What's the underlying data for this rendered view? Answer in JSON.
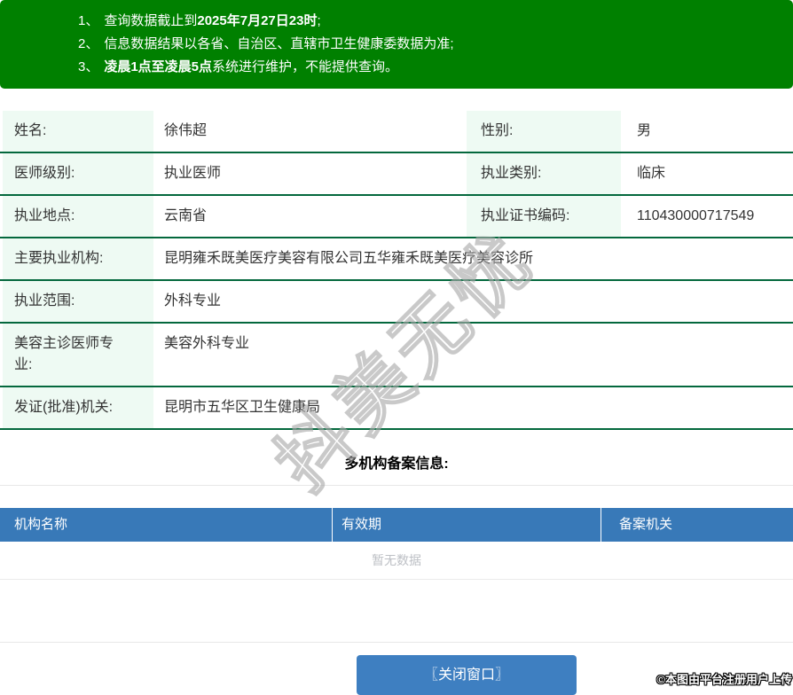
{
  "colors": {
    "banner_green": "#008000",
    "row_divider_green": "#04683d",
    "label_bg_mint": "#eefaf3",
    "filing_header_blue": "#3879b8",
    "close_button_blue": "#3e7fc1",
    "empty_text_gray": "#bdc0c5"
  },
  "notice": {
    "items": [
      {
        "num": "1、",
        "pre": "查询数据截止到",
        "bold": "2025年7月27日23时",
        "post": ";"
      },
      {
        "num": "2、",
        "pre": "信息数据结果以各省、自治区、直辖市卫生健康委数据为准;",
        "bold": "",
        "post": ""
      },
      {
        "num": "3、",
        "pre": "",
        "bold": "凌晨1点至凌晨5点",
        "post": "系统进行维护，不能提供查询。"
      }
    ]
  },
  "info": {
    "rows": [
      {
        "cells": [
          {
            "label": "姓名:",
            "value": "徐伟超"
          },
          {
            "label": "性别:",
            "value": "男"
          }
        ]
      },
      {
        "cells": [
          {
            "label": "医师级别:",
            "value": "执业医师"
          },
          {
            "label": "执业类别:",
            "value": "临床"
          }
        ]
      },
      {
        "cells": [
          {
            "label": "执业地点:",
            "value": "云南省"
          },
          {
            "label": "执业证书编码:",
            "value": "110430000717549"
          }
        ]
      },
      {
        "cells": [
          {
            "label": "主要执业机构:",
            "value": "昆明雍禾既美医疗美容有限公司五华雍禾既美医疗美容诊所"
          }
        ]
      },
      {
        "cells": [
          {
            "label": "执业范围:",
            "value": "外科专业"
          }
        ]
      },
      {
        "cells": [
          {
            "label": "美容主诊医师专业:",
            "value": "美容外科专业"
          }
        ]
      },
      {
        "cells": [
          {
            "label": "发证(批准)机关:",
            "value": "昆明市五华区卫生健康局"
          }
        ]
      }
    ]
  },
  "filing": {
    "title": "多机构备案信息:",
    "headers": [
      "机构名称",
      "有效期",
      "备案机关"
    ],
    "empty_text": "暂无数据"
  },
  "footer": {
    "close_button": "〖关闭窗口〗",
    "credit": "©本图由平台注册用户上传"
  },
  "watermark": "抖美无忧"
}
